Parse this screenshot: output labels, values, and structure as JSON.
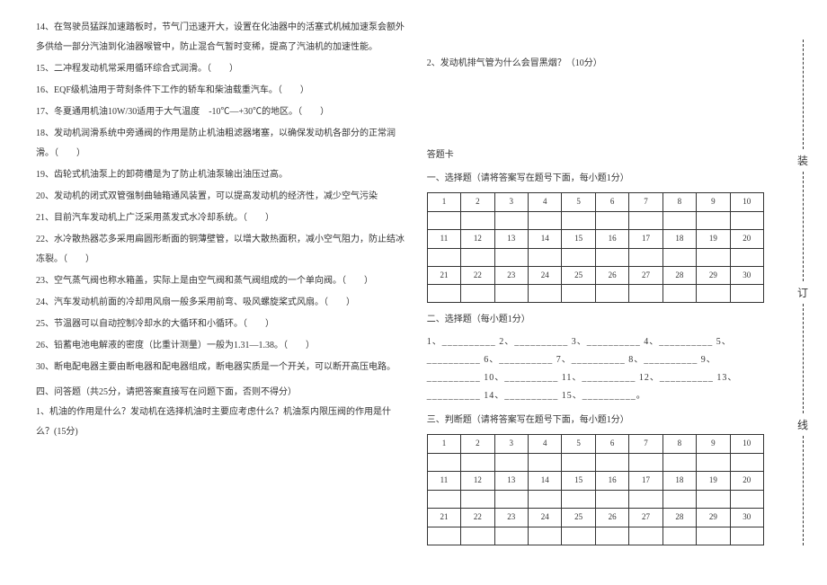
{
  "left": {
    "q14": "14、在驾驶员猛踩加速踏板时，节气门迅速开大，设置在化油器中的活塞式机械加速泵会额外多供给一部分汽油到化油器喉管中，防止混合气暂时变稀，提高了汽油机的加速性能。",
    "q15": "15、二冲程发动机常采用循环综合式润滑。（　　）",
    "q16": "16、EQF级机油用于苛刻条件下工作的轿车和柴油载重汽车。（　　）",
    "q17": "17、冬夏通用机油10W/30适用于大气温度　-10℃—+30℃的地区。（　　）",
    "q18": "18、发动机润滑系统中旁通阀的作用是防止机油粗滤器堵塞，以确保发动机各部分的正常润滑。（　　）",
    "q19": "19、齿轮式机油泵上的卸荷槽是为了防止机油泵输出油压过高。",
    "q20": "20、发动机的闭式双管强制曲轴箱通风装置，可以提高发动机的经济性，减少空气污染",
    "q21": "21、目前汽车发动机上广泛采用蒸发式水冷却系统。（　　）",
    "q22": "22、水冷散热器芯多采用扁圆形断面的铜薄壁管，以增大散热面积，减小空气阻力，防止结冰冻裂。（　　）",
    "q23": "23、空气蒸气阀也称水箱盖，实际上是由空气阀和蒸气阀组成的一个单向阀。（　　）",
    "q24": "24、汽车发动机前面的冷却用风扇一般多采用前弯、吸风螺旋桨式风扇。（　　）",
    "q25": "25、节温器可以自动控制冷却水的大循环和小循环。（　　）",
    "q26": "26、铅蓄电池电解液的密度（比重计测量）一般为1.31—1.38。（　　）",
    "q30": "30、断电配电器主要由断电器和配电器组成，断电器实质是一个开关，可以断开高压电路。",
    "section4": "四、问答题（共25分，请把答案直接写在问题下面，否则不得分）",
    "essay1": "1、机油的作用是什么？发动机在选择机油时主要应考虑什么？机油泵内限压阀的作用是什么？(15分)"
  },
  "right": {
    "essay2": "2、发动机排气管为什么会冒黑烟？（10分）",
    "cardTitle": "答题卡",
    "sec1": "一、选择题（请将答案写在题号下面，每小题1分）",
    "sec2": "二、选择题（每小题1分）",
    "fill": "1、__________ 2、__________ 3、__________ 4、__________ 5、__________ 6、__________ 7、__________ 8、__________ 9、__________ 10、__________ 11、__________ 12、__________ 13、__________ 14、__________ 15、__________。",
    "sec3": "三、判断题（请将答案写在题号下面，每小题1分）",
    "nums1": [
      "1",
      "2",
      "3",
      "4",
      "5",
      "6",
      "7",
      "8",
      "9",
      "10"
    ],
    "nums2": [
      "11",
      "12",
      "13",
      "14",
      "15",
      "16",
      "17",
      "18",
      "19",
      "20"
    ],
    "nums3": [
      "21",
      "22",
      "23",
      "24",
      "25",
      "26",
      "27",
      "28",
      "29",
      "30"
    ]
  },
  "binding": {
    "c1": "装",
    "c2": "订",
    "c3": "线"
  }
}
